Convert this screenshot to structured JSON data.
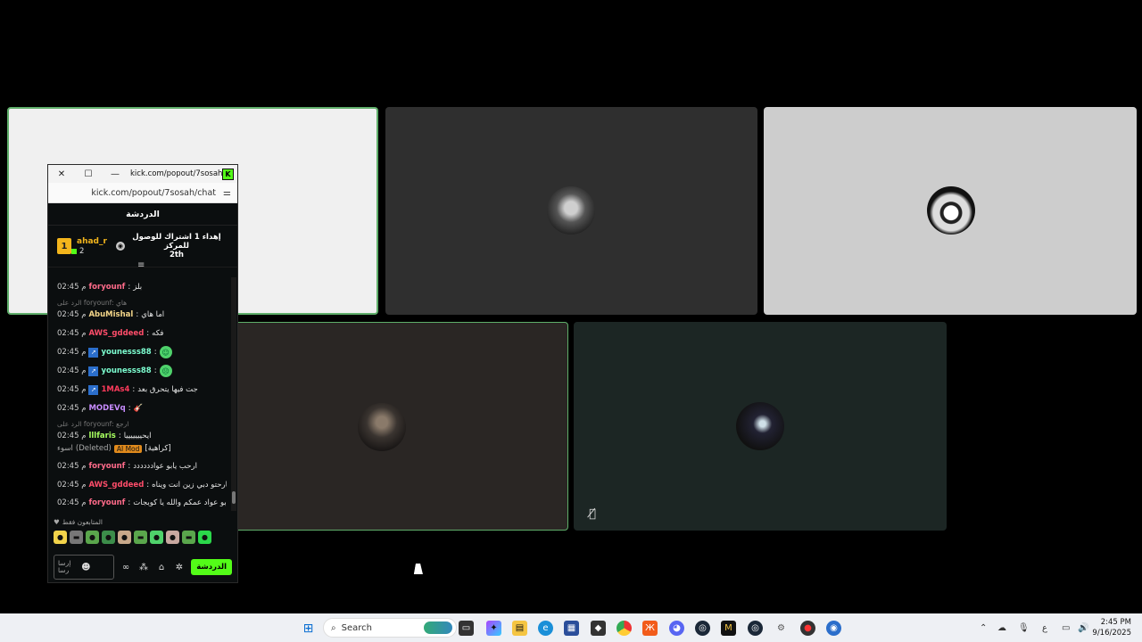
{
  "popout": {
    "window_title": "kick.com/popout/7sosah/ch...",
    "url": "kick.com/popout/7sosah/chat",
    "header": "الدردشة",
    "pinned": {
      "rank": "1",
      "user": "ahad_r",
      "count": "2",
      "text_line1": "إهداء 1 اشتراك للوصول للمركز",
      "text_line2": "2th"
    },
    "messages": [
      {
        "time": "02:45 م",
        "user": "foryounf",
        "text": "بلز",
        "color": "#ff6b8a"
      },
      {
        "time": "02:45 م",
        "user": "AbuMishal",
        "text": "اما هاي",
        "color": "#f5d78a",
        "reply": "الرد على foryounf: هاي"
      },
      {
        "time": "02:45 م",
        "user": "AWS_gddeed",
        "text": "فكه",
        "color": "#ff4d6a"
      },
      {
        "time": "02:45 م",
        "user": "younesss88",
        "text": "",
        "color": "#7dffd1",
        "emote": "☺"
      },
      {
        "time": "02:45 م",
        "user": "younesss88",
        "text": "",
        "color": "#7dffd1",
        "emote": "☹"
      },
      {
        "time": "02:45 م",
        "user": "1MAs4",
        "text": "جت فيها يتحرق بعد",
        "color": "#ff3b5c"
      },
      {
        "time": "02:45 م",
        "user": "MODEVq",
        "text": "",
        "color": "#c88cff"
      },
      {
        "time": "02:45 م",
        "user": "lllfaris",
        "text": "ايحيييييييا",
        "color": "#a8ff60",
        "reply": "الرد على foryounf: ارجع"
      },
      {
        "time": "02:45 م",
        "user": "foryounf",
        "text": "ارحب يابو عوادددددد",
        "color": "#ff6b8a"
      },
      {
        "time": "02:45 م",
        "user": "AWS_gddeed",
        "text": "طيب مارحتو دبي زين انت ويناه",
        "color": "#ff4d6a"
      },
      {
        "time": "02:45 م",
        "user": "foryounf",
        "text": "ابو عواد عمكم والله يا كوبجات",
        "color": "#ff6b8a"
      }
    ],
    "deleted": {
      "label": "(Deleted)",
      "prefix": "اسوء",
      "badge": "AI Mod",
      "reason": "[كراهية]"
    },
    "subs_label": "المتابعون فقط",
    "input_placeholder_1": "إرسا",
    "input_placeholder_2": "رسا",
    "send_label": "الدردشة"
  },
  "taskbar": {
    "search": "Search",
    "lang": "ع",
    "time": "2:45 PM",
    "date": "9/16/2025"
  }
}
